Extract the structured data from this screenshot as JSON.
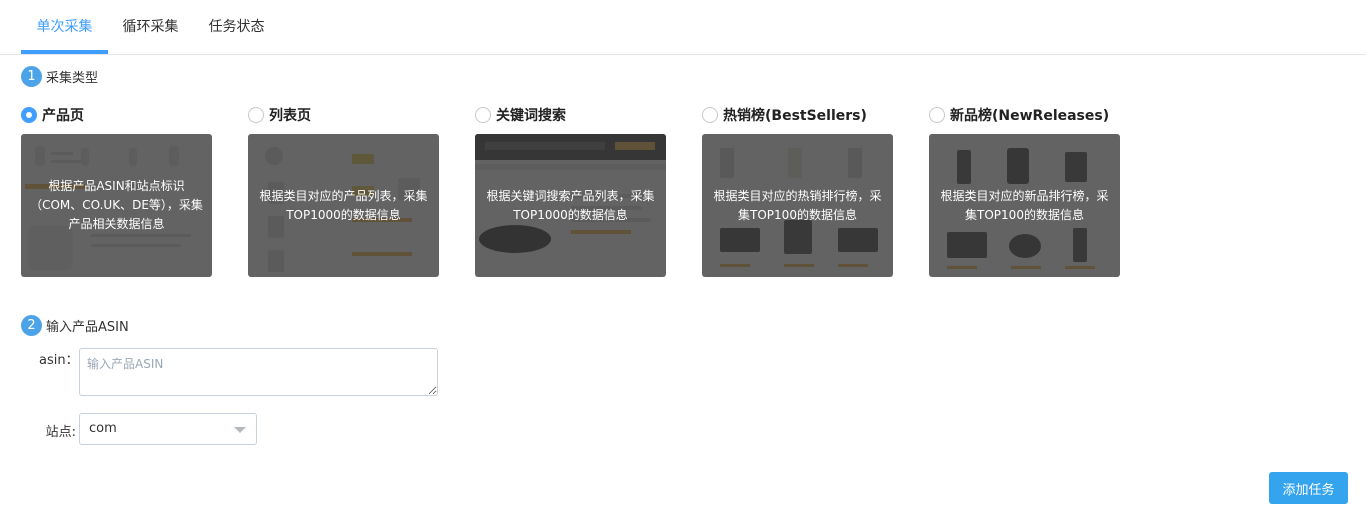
{
  "tabs": [
    {
      "label": "单次采集",
      "active": true
    },
    {
      "label": "循环采集",
      "active": false
    },
    {
      "label": "任务状态",
      "active": false
    }
  ],
  "step1": {
    "num": "1",
    "title": "采集类型"
  },
  "options": [
    {
      "label": "产品页",
      "checked": true,
      "desc": "根据产品ASIN和站点标识（COM、CO.UK、DE等），采集产品相关数据信息"
    },
    {
      "label": "列表页",
      "checked": false,
      "desc": "根据类目对应的产品列表，采集TOP1000的数据信息"
    },
    {
      "label": "关键词搜索",
      "checked": false,
      "desc": "根据关键词搜索产品列表，采集TOP1000的数据信息"
    },
    {
      "label": "热销榜(BestSellers)",
      "checked": false,
      "desc": "根据类目对应的热销排行榜，采集TOP100的数据信息"
    },
    {
      "label": "新品榜(NewReleases)",
      "checked": false,
      "desc": "根据类目对应的新品排行榜，采集TOP100的数据信息"
    }
  ],
  "step2": {
    "num": "2",
    "title": "输入产品ASIN"
  },
  "form": {
    "asin_label": "asin：",
    "asin_value": "",
    "asin_placeholder": "输入产品ASIN",
    "site_label": "站点:",
    "site_value": "com"
  },
  "add_button": "添加任务",
  "colors": {
    "accent": "#409eff",
    "step_badge": "#4da3e8",
    "button": "#35a4ef"
  }
}
